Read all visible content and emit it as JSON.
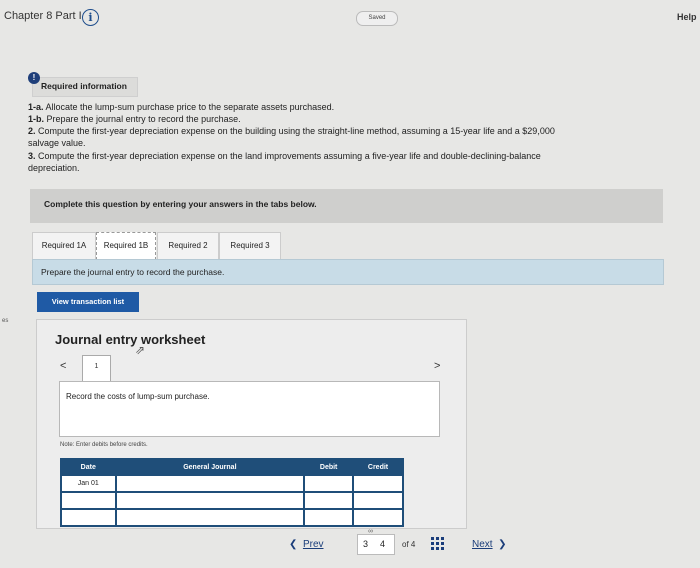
{
  "header": {
    "chapter": "Chapter 8 Part I",
    "info_icon": "i",
    "saved": "Saved",
    "help": "Help"
  },
  "required_info": {
    "badge": "!",
    "label": "Required information"
  },
  "instructions": [
    {
      "prefix": "1-a.",
      "text": " Allocate the lump-sum purchase price to the separate assets purchased."
    },
    {
      "prefix": "1-b.",
      "text": " Prepare the journal entry to record the purchase."
    },
    {
      "prefix": "2.",
      "text": " Compute the first-year depreciation expense on the building using the straight-line method, assuming a 15-year life and a $29,000"
    },
    {
      "prefix": "",
      "text": "salvage value."
    },
    {
      "prefix": "3.",
      "text": " Compute the first-year depreciation expense on the land improvements assuming a five-year life and double-declining-balance"
    },
    {
      "prefix": "",
      "text": "depreciation."
    }
  ],
  "complete_text": "Complete this question by entering your answers in the tabs below.",
  "tabs": [
    "Required 1A",
    "Required 1B",
    "Required 2",
    "Required 3"
  ],
  "prepare_text": "Prepare the journal entry to record the purchase.",
  "view_button": "View transaction list",
  "side_label": "es",
  "worksheet": {
    "title": "Journal entry worksheet",
    "nav_left": "<",
    "nav_right": ">",
    "page_tab": "1",
    "record_text": "Record the costs of lump-sum purchase.",
    "note": "Note: Enter debits before credits.",
    "columns": [
      "Date",
      "General Journal",
      "Debit",
      "Credit"
    ],
    "rows": [
      [
        "Jan 01",
        "",
        "",
        ""
      ],
      [
        "",
        "",
        "",
        ""
      ],
      [
        "",
        "",
        "",
        ""
      ]
    ]
  },
  "pager": {
    "prev": "Prev",
    "page_a": "3",
    "page_b": "4",
    "of": "of 4",
    "next": "Next"
  }
}
